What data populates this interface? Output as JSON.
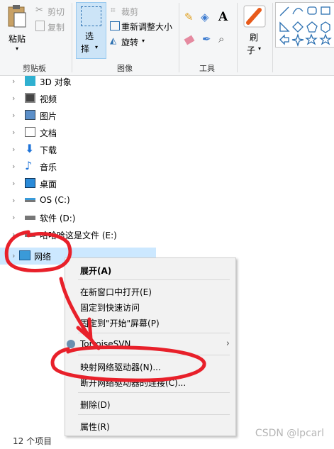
{
  "ribbon": {
    "clipboard": {
      "paste": "粘贴",
      "cut": "剪切",
      "copy": "复制",
      "label": "剪贴板"
    },
    "image": {
      "select_1": "选",
      "select_2": "择",
      "crop": "裁剪",
      "resize": "重新调整大小",
      "rotate": "旋转",
      "label": "图像"
    },
    "tools": {
      "label": "工具",
      "text_tool": "A"
    },
    "brush": {
      "label_1": "刷",
      "label_2": "子"
    }
  },
  "tree": {
    "items": [
      {
        "label": "3D 对象",
        "icon": "3d-objects-icon"
      },
      {
        "label": "视频",
        "icon": "videos-icon"
      },
      {
        "label": "图片",
        "icon": "pictures-icon"
      },
      {
        "label": "文档",
        "icon": "documents-icon"
      },
      {
        "label": "下载",
        "icon": "downloads-icon"
      },
      {
        "label": "音乐",
        "icon": "music-icon"
      },
      {
        "label": "桌面",
        "icon": "desktop-icon"
      },
      {
        "label": "OS (C:)",
        "icon": "drive-c-icon"
      },
      {
        "label": "软件 (D:)",
        "icon": "drive-d-icon"
      },
      {
        "label": "哈哈哈这是文件 (E:)",
        "icon": "drive-e-icon"
      },
      {
        "label": "网络",
        "icon": "network-icon"
      }
    ]
  },
  "status": {
    "count": "12 个项目"
  },
  "context_menu": {
    "expand": "展开(A)",
    "open_new_window": "在新窗口中打开(E)",
    "pin_quick": "固定到快速访问",
    "pin_start": "固定到\"开始\"屏幕(P)",
    "tortoise": "TortoiseSVN",
    "map_drive": "映射网络驱动器(N)...",
    "disconnect": "断开网络驱动器的连接(C)...",
    "delete": "删除(D)",
    "properties": "属性(R)",
    "submenu_arrow": "›"
  },
  "watermark": "CSDN @lpcarl",
  "colors": {
    "annotation": "#e8202a",
    "selection": "#cce8ff",
    "accent": "#0078d7"
  }
}
